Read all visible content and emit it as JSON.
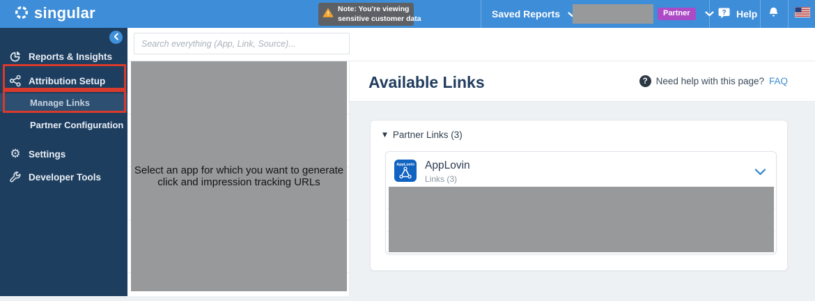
{
  "navbar": {
    "brand": "singular",
    "note_line1": "Note: You're viewing",
    "note_line2": "sensitive customer data",
    "saved_reports": "Saved Reports",
    "partner_badge": "Partner",
    "help": "Help"
  },
  "sidebar": {
    "items": [
      {
        "label": "Reports & Insights"
      },
      {
        "label": "Attribution Setup"
      },
      {
        "label": "Manage Links"
      },
      {
        "label": "Partner Configuration"
      },
      {
        "label": "Settings"
      },
      {
        "label": "Developer Tools"
      }
    ]
  },
  "search": {
    "placeholder": "Search everything (App, Link, Source)..."
  },
  "app_panel": {
    "message": "Select an app for which you want to generate click and impression tracking URLs"
  },
  "main": {
    "title": "Available Links",
    "help_prompt": "Need help with this page?",
    "faq": "FAQ",
    "group_header": "Partner Links (3)",
    "card": {
      "name": "AppLovin",
      "links_label": "Links (3)",
      "icon_label": "AppLovin"
    }
  },
  "icons": {
    "triangle": "▼",
    "gear": "⚙",
    "question_mark": "?"
  },
  "colors": {
    "navbar_blue": "#3e8dd8",
    "sidebar_navy": "#1e3e5f",
    "active_row_blue": "#2d4f72",
    "annotation_red": "#d93a2b",
    "link_blue": "#3d8fd1",
    "partner_badge_purple": "#ad4bc7",
    "warning_orange": "#f0a32e",
    "redaction_gray": "#98999a"
  }
}
